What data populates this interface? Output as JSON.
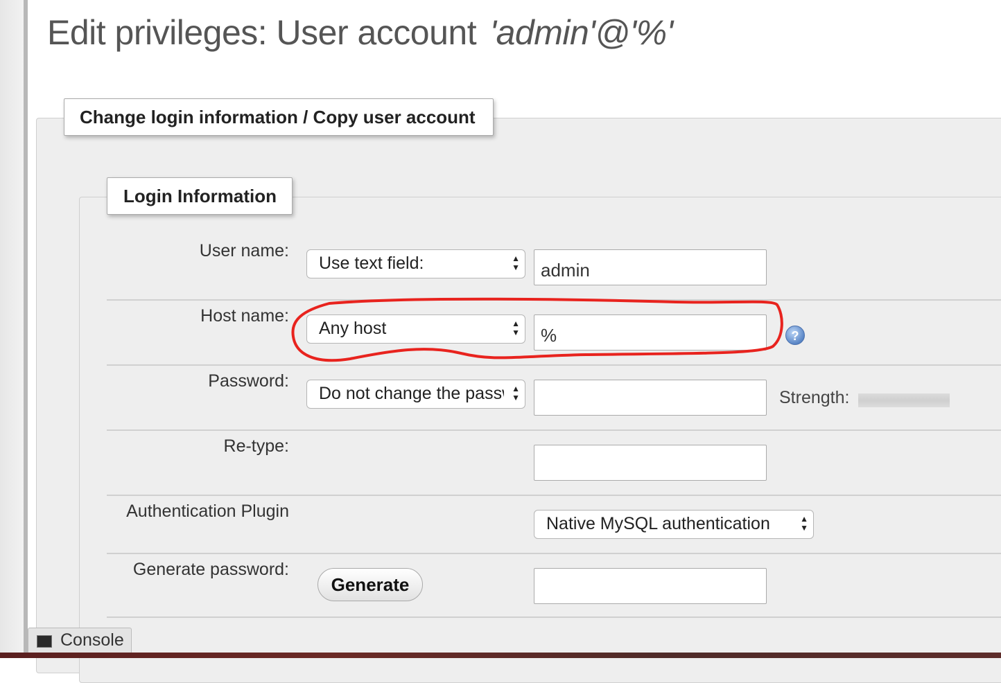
{
  "page": {
    "title": "Edit privileges: User account",
    "account": "'admin'@'%'"
  },
  "fieldsets": {
    "outer_legend": "Change login information / Copy user account",
    "inner_legend": "Login Information"
  },
  "form": {
    "username": {
      "label": "User name:",
      "select_value": "Use text field:",
      "input_value": "admin"
    },
    "hostname": {
      "label": "Host name:",
      "select_value": "Any host",
      "input_value": "%"
    },
    "password": {
      "label": "Password:",
      "select_value": "Do not change the password",
      "input_value": "",
      "strength_label": "Strength:",
      "strength_value": 0
    },
    "retype": {
      "label": "Re-type:",
      "input_value": ""
    },
    "auth_plugin": {
      "label": "Authentication Plugin",
      "select_value": "Native MySQL authentication"
    },
    "generate": {
      "label": "Generate password:",
      "button_label": "Generate",
      "input_value": ""
    }
  },
  "console": {
    "label": "Console"
  },
  "annotation": {
    "color": "#e8231e"
  },
  "icons": {
    "help": "help-icon",
    "console": "console-icon",
    "select_arrows": "updown-arrows-icon"
  }
}
